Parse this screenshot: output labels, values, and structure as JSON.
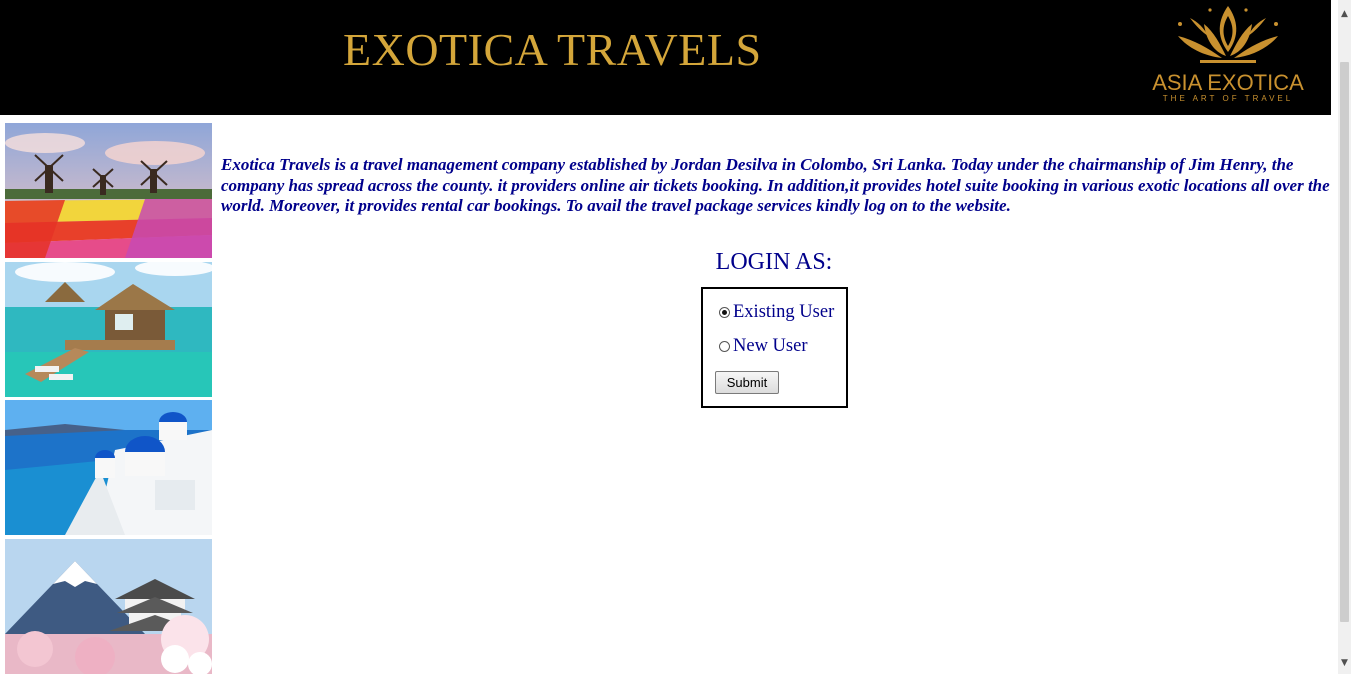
{
  "header": {
    "title": "EXOTICA TRAVELS",
    "logo_name": "ASIA EXOTICA",
    "logo_tagline": "THE ART OF TRAVEL",
    "title_color": "#d4a63a",
    "background": "#000000"
  },
  "sidebar_images": [
    {
      "icon": "windmills-tulips-image"
    },
    {
      "icon": "overwater-bungalow-image"
    },
    {
      "icon": "santorini-domes-image"
    },
    {
      "icon": "mount-fuji-castle-image"
    }
  ],
  "intro_text": "Exotica Travels is a travel management company established by Jordan Desilva in Colombo, Sri Lanka. Today under the chairmanship of Jim Henry, the company has spread across the county. it providers online air tickets booking. In addition,it provides hotel suite booking in various exotic locations all over the world. Moreover, it provides rental car bookings. To avail the travel package services kindly log on to the website.",
  "login": {
    "heading": "LOGIN AS:",
    "options": [
      {
        "label": "Existing User",
        "checked": true
      },
      {
        "label": "New User",
        "checked": false
      }
    ],
    "submit_label": "Submit"
  },
  "colors": {
    "text_accent": "#00008b",
    "gold": "#c9912f"
  }
}
